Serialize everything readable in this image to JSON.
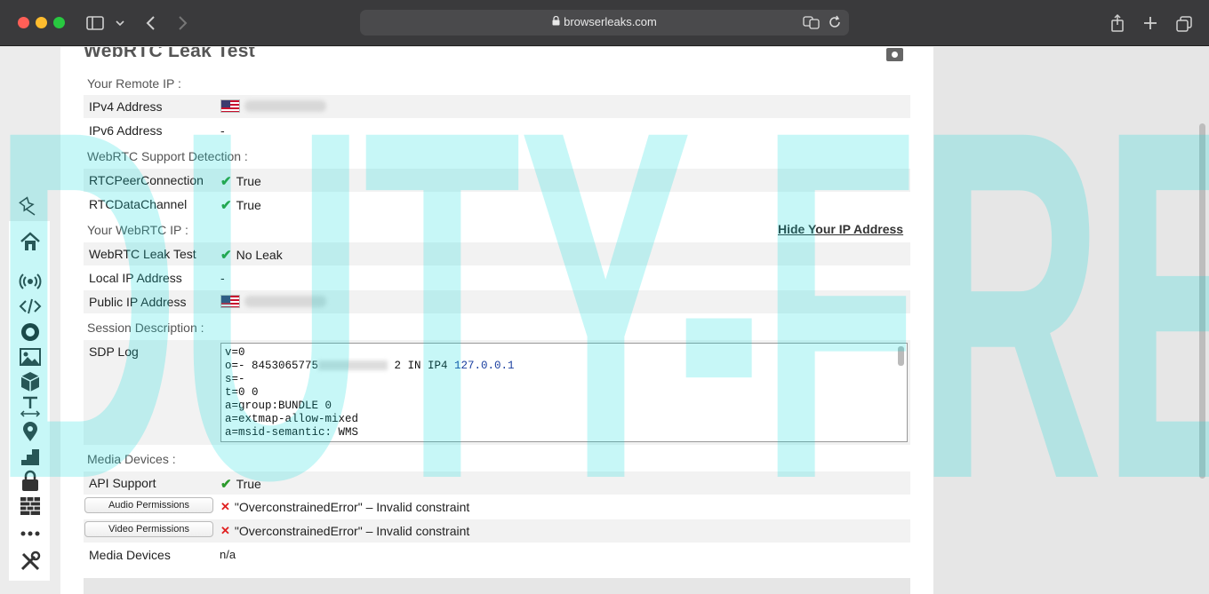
{
  "browser": {
    "url": "browserleaks.com"
  },
  "page": {
    "title": "WebRTC Leak Test",
    "hide_ip_link": "Hide Your IP Address"
  },
  "sections": {
    "remote_ip": "Your Remote IP :",
    "support": "WebRTC Support Detection :",
    "webrtc_ip": "Your WebRTC IP :",
    "session": "Session Description :",
    "media": "Media Devices :"
  },
  "rows": {
    "ipv4": {
      "label": "IPv4 Address",
      "value": ""
    },
    "ipv6": {
      "label": "IPv6 Address",
      "value": "-"
    },
    "peer": {
      "label": "RTCPeerConnection",
      "value": "True"
    },
    "datachannel": {
      "label": "RTCDataChannel",
      "value": "True"
    },
    "leaktest": {
      "label": "WebRTC Leak Test",
      "value": "No Leak"
    },
    "local_ip": {
      "label": "Local IP Address",
      "value": "-"
    },
    "public_ip": {
      "label": "Public IP Address",
      "value": ""
    },
    "sdp": {
      "label": "SDP Log"
    },
    "api": {
      "label": "API Support",
      "value": "True"
    },
    "audio": {
      "label": "Audio Permissions",
      "value": "\"OverconstrainedError\" – Invalid constraint"
    },
    "video": {
      "label": "Video Permissions",
      "value": "\"OverconstrainedError\" – Invalid constraint"
    },
    "media_devices": {
      "label": "Media Devices",
      "value": "n/a"
    }
  },
  "sdp_log": {
    "line1": "v=0",
    "line2_prefix": "o=- 8453065775",
    "line2_suffix": " 2 IN IP4 ",
    "line2_ip": "127.0.0.1",
    "line3": "s=-",
    "line4": "t=0 0",
    "line5": "a=group:BUNDLE 0",
    "line6": "a=extmap-allow-mixed",
    "line7": "a=msid-semantic: WMS"
  },
  "watermark": "DUTY-FREE.CC"
}
